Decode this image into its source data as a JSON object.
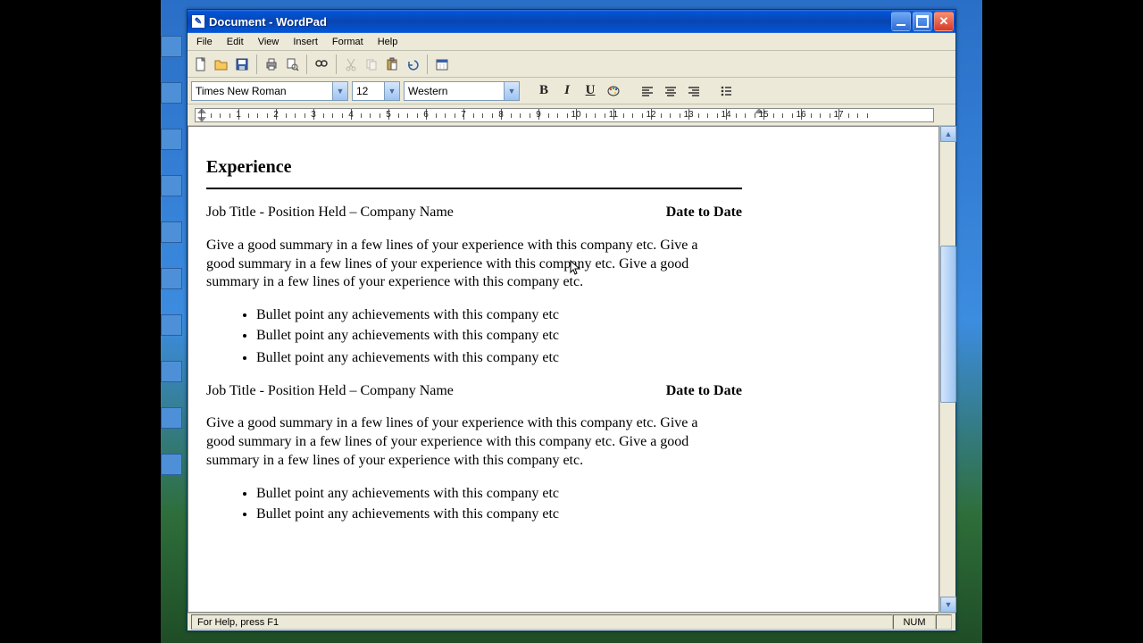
{
  "window": {
    "title": "Document - WordPad"
  },
  "menu": {
    "file": "File",
    "edit": "Edit",
    "view": "View",
    "insert": "Insert",
    "format": "Format",
    "help": "Help"
  },
  "format": {
    "font": "Times New Roman",
    "size": "12",
    "script": "Western",
    "bold": "B",
    "italic": "I",
    "underline": "U"
  },
  "document": {
    "heading": "Experience",
    "job1": {
      "title": "Job Title - Position Held – Company Name",
      "dates": "Date to Date",
      "summary": "Give a good summary in a few lines of your experience with this company etc.  Give a good summary in a few lines of your experience with this company etc. Give a good summary in a few lines of your experience with this company etc.",
      "bullet1": "Bullet point any achievements with this company etc",
      "bullet2": "Bullet point any achievements with this company etc",
      "bullet3": "Bullet point any achievements with this company etc"
    },
    "job2": {
      "title": "Job Title - Position Held – Company Name",
      "dates": "Date to Date",
      "summary": "Give a good summary in a few lines of your experience with this company etc.  Give a good summary in a few lines of your experience with this company etc. Give a good summary in a few lines of your experience with this company etc.",
      "bullet1": "Bullet point any achievements with this company etc",
      "bullet2": "Bullet point any achievements with this company etc"
    }
  },
  "status": {
    "help": "For Help, press F1",
    "num": "NUM"
  },
  "ruler": {
    "numbers": [
      "1",
      "2",
      "3",
      "4",
      "5",
      "6",
      "7",
      "8",
      "9",
      "10",
      "11",
      "12",
      "13",
      "14",
      "15",
      "16",
      "17"
    ]
  }
}
